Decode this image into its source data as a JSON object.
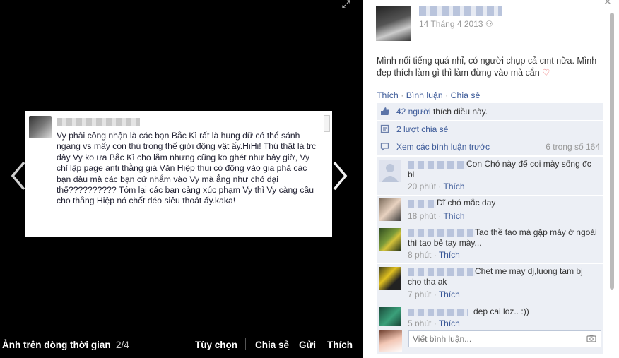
{
  "viewer": {
    "album_title": "Ảnh trên dòng thời gian",
    "position": "2/4",
    "actions": [
      "Tùy chọn",
      "Chia sẻ",
      "Gửi",
      "Thích"
    ],
    "photo_text": "Vy phải công nhận là các bạn Bắc Kì rất là hung dữ có thể sánh ngang vs mấy con thú trong thế giới động vật ấy.HiHi! Thú thật là trc đây Vy ko ưa Bắc Kì cho lắm nhưng cũng ko ghét như bây giờ, Vy chỉ lập page anti thằng già Văn Hiệp thui có động vào gia phả các bạn đâu mà các bạn cứ nhắm vào Vy mà ẳng như chó dại thế?????????? Tóm lại các bạn càng xúc phạm Vy thì Vy càng cầu cho thằng Hiệp nó chết đéo siêu thoát ấy.kaka!"
  },
  "post": {
    "date": "14 Tháng 4 2013",
    "text": "Mình nổi tiếng quá nhỉ, có người chụp cả cmt nữa. Mình đẹp thích làm gì thì làm đừng vào mà cắn",
    "actions": {
      "like": "Thích",
      "comment": "Bình luận",
      "share": "Chia sẻ",
      "separator": "·"
    },
    "likes_link": "42 người",
    "likes_suffix": "thích điều này.",
    "shares": "2 lượt chia sẻ",
    "view_previous": "Xem các bình luận trước",
    "comment_count": "6 trong số 164"
  },
  "comments": [
    {
      "text": "Con Chó này để coi mày sống đc bl",
      "time": "20 phút",
      "like": "Thích"
    },
    {
      "text": "Dĩ chó mắc day",
      "time": "18 phút",
      "like": "Thích"
    },
    {
      "text": "Tao thề tao mà gặp mày ở ngoài thì tao bẻ tay mày...",
      "time": "8 phút",
      "like": "Thích"
    },
    {
      "text": "Chet me may dj,luong tam bj cho tha ak",
      "time": "7 phút",
      "like": "Thích"
    },
    {
      "text": "dep cai loz.. :))",
      "time": "5 phút",
      "like": "Thích"
    }
  ],
  "composer": {
    "placeholder": "Viết bình luận..."
  },
  "colors": {
    "link": "#3b5998",
    "panel_box": "#eceff5",
    "background": "#000000"
  }
}
